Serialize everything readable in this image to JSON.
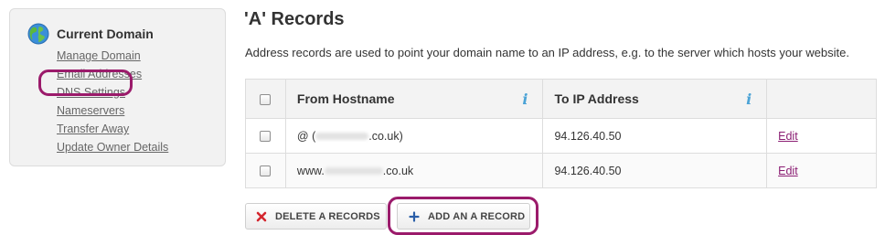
{
  "sidebar": {
    "title": "Current Domain",
    "links": [
      {
        "label": "Manage Domain"
      },
      {
        "label": "Email Addresses"
      },
      {
        "label": "DNS Settings"
      },
      {
        "label": "Nameservers"
      },
      {
        "label": "Transfer Away"
      },
      {
        "label": "Update Owner Details"
      }
    ]
  },
  "main": {
    "title": "'A' Records",
    "description": "Address records are used to point your domain name to an IP address, e.g. to the server which hosts your website.",
    "table": {
      "headers": {
        "hostname": "From Hostname",
        "ip": "To IP Address"
      },
      "rows": [
        {
          "host_prefix": "@ (",
          "host_suffix": ".co.uk)",
          "ip": "94.126.40.50",
          "action": "Edit"
        },
        {
          "host_prefix": "www.",
          "host_suffix": ".co.uk",
          "ip": "94.126.40.50",
          "action": "Edit"
        }
      ]
    },
    "buttons": {
      "delete": "DELETE A RECORDS",
      "add": "ADD AN A RECORD"
    }
  },
  "colors": {
    "highlight": "#9b1b6b",
    "link": "#8b1e73",
    "info_icon": "#4ba3d6",
    "delete_icon": "#d4262e",
    "add_icon": "#2a5ea8"
  }
}
